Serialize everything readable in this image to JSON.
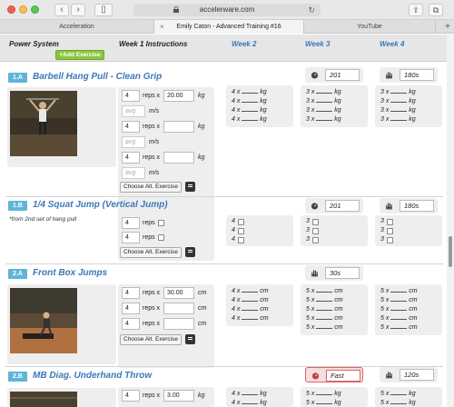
{
  "browser": {
    "url": "accelerware.com",
    "tabs": [
      "Acceleration",
      "Emily Caton - Advanced Training #16",
      "YouTube"
    ],
    "add_tab": "+"
  },
  "header": {
    "system": "Power System",
    "add_exercise": "+Add Exercise",
    "weeks": [
      "Week 1 Instructions",
      "Week 2",
      "Week 3",
      "Week 4"
    ]
  },
  "exercises": [
    {
      "badge": "1.A",
      "title": "Barbell Hang Pull - Clean Grip",
      "rest_icon": "stopwatch-icon",
      "rest_value": "201",
      "tempo_icon": "hand-icon",
      "tempo_value": "180s",
      "sets": [
        {
          "reps": "4",
          "load": "20.00",
          "unit": "kg",
          "avg": "avg",
          "avg_unit": "m/s"
        },
        {
          "reps": "4",
          "load": "",
          "unit": "kg",
          "avg": "avg",
          "avg_unit": "m/s"
        },
        {
          "reps": "4",
          "load": "",
          "unit": "kg",
          "avg": "avg",
          "avg_unit": "m/s"
        }
      ],
      "alt_label": "Choose Alt. Exercise",
      "week2": [
        "4 x",
        "4 x",
        "4 x",
        "4 x"
      ],
      "week2_unit": "kg",
      "week3": [
        "3 x",
        "3 x",
        "3 x",
        "3 x"
      ],
      "week3_unit": "kg",
      "week4": [
        "3 x",
        "3 x",
        "3 x",
        "3 x"
      ],
      "week4_unit": "kg"
    },
    {
      "badge": "1.B",
      "title": "1/4 Squat Jump (Vertical Jump)",
      "note": "*from 2nd set of hang pull",
      "rest_value": "201",
      "tempo_value": "180s",
      "sets": [
        {
          "reps": "4",
          "label": "reps"
        },
        {
          "reps": "4",
          "label": "reps"
        }
      ],
      "alt_label": "Choose Alt. Exercise",
      "week2": [
        "4",
        "4",
        "4"
      ],
      "week3": [
        "3",
        "3",
        "3"
      ],
      "week4": [
        "3",
        "3",
        "3"
      ]
    },
    {
      "badge": "2.A",
      "title": "Front Box Jumps",
      "tempo_value": "30s",
      "sets": [
        {
          "reps": "4",
          "load": "30.00",
          "unit": "cm"
        },
        {
          "reps": "4",
          "load": "",
          "unit": "cm"
        },
        {
          "reps": "4",
          "load": "",
          "unit": "cm"
        }
      ],
      "alt_label": "Choose Alt. Exercise",
      "week2": [
        "4 x",
        "4 x",
        "4 x",
        "4 x"
      ],
      "week2_unit": "cm",
      "week3": [
        "5 x",
        "5 x",
        "5 x",
        "5 x",
        "5 x"
      ],
      "week3_unit": "cm",
      "week4": [
        "5 x",
        "5 x",
        "5 x",
        "5 x",
        "5 x"
      ],
      "week4_unit": "cm"
    },
    {
      "badge": "2.B",
      "title": "MB Diag. Underhand Throw",
      "rest_value": "Fast",
      "tempo_value": "120s",
      "sets": [
        {
          "reps": "4",
          "load": "3.00",
          "unit": "kg"
        }
      ],
      "week2": [
        "4 x",
        "4 x"
      ],
      "week2_unit": "kg",
      "week3": [
        "5 x",
        "5 x"
      ],
      "week3_unit": "kg",
      "week4": [
        "5 x",
        "5 x"
      ],
      "week4_unit": "kg"
    }
  ],
  "reps_x": "reps x",
  "colors": {
    "accent_blue": "#3a78b8",
    "badge": "#5eb5d9",
    "add_green": "#8cc63f",
    "fast_red": "#d66666"
  }
}
